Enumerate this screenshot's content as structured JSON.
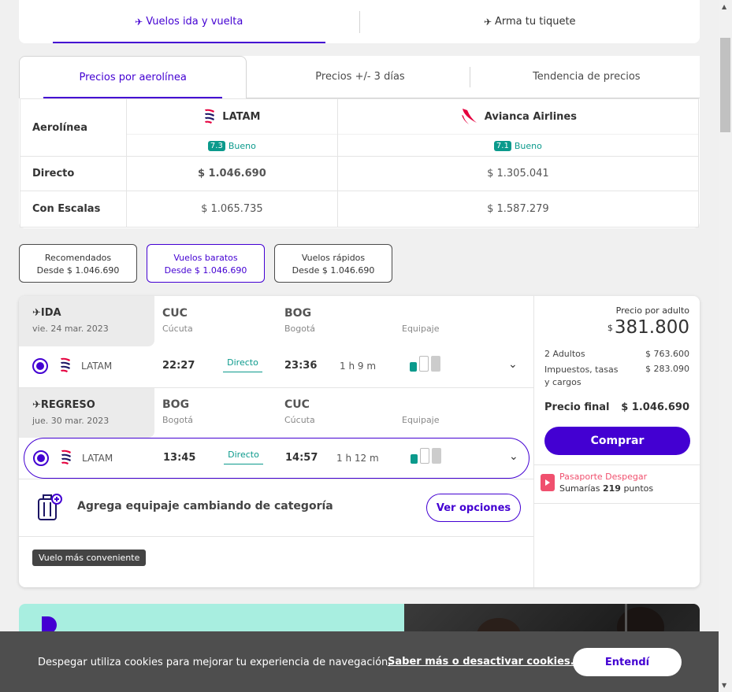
{
  "top_tabs": [
    {
      "label": "Vuelos ida y vuelta",
      "active": true
    },
    {
      "label": "Arma tu tiquete",
      "active": false
    }
  ],
  "matrix": {
    "tabs": [
      {
        "label": "Precios por aerolínea",
        "active": true
      },
      {
        "label": "Precios +/- 3 días",
        "active": false
      },
      {
        "label": "Tendencia de precios",
        "active": false
      }
    ],
    "row_labels": {
      "airline": "Aerolínea",
      "direct": "Directo",
      "stops": "Con Escalas"
    },
    "airlines": [
      {
        "name": "LATAM",
        "score": "7.3",
        "rating": "Bueno",
        "direct": "$ 1.046.690",
        "stops": "$ 1.065.735"
      },
      {
        "name": "Avianca Airlines",
        "score": "7.1",
        "rating": "Bueno",
        "direct": "$ 1.305.041",
        "stops": "$ 1.587.279"
      }
    ]
  },
  "filters": [
    {
      "title": "Recomendados",
      "price": "Desde $ 1.046.690",
      "active": false
    },
    {
      "title": "Vuelos baratos",
      "price": "Desde $ 1.046.690",
      "active": true
    },
    {
      "title": "Vuelos rápidos",
      "price": "Desde $ 1.046.690",
      "active": false
    }
  ],
  "outbound": {
    "title": "IDA",
    "date": "vie. 24 mar. 2023",
    "from_code": "CUC",
    "from_city": "Cúcuta",
    "to_code": "BOG",
    "to_city": "Bogotá",
    "baggage_label": "Equipaje",
    "airline": "LATAM",
    "depart": "22:27",
    "type": "Directo",
    "arrive": "23:36",
    "duration": "1 h 9 m"
  },
  "return": {
    "title": "REGRESO",
    "date": "jue. 30 mar. 2023",
    "from_code": "BOG",
    "from_city": "Bogotá",
    "to_code": "CUC",
    "to_city": "Cúcuta",
    "baggage_label": "Equipaje",
    "airline": "LATAM",
    "depart": "13:45",
    "type": "Directo",
    "arrive": "14:57",
    "duration": "1 h 12 m"
  },
  "upsell": {
    "text": "Agrega equipaje cambiando de categoría",
    "button": "Ver opciones"
  },
  "badge": "Vuelo más conveniente",
  "pricing": {
    "label": "Precio por adulto",
    "currency": "$",
    "per_adult": "381.800",
    "adults_label": "2 Adultos",
    "adults_value": "$ 763.600",
    "taxes_label_1": "Impuestos, tasas",
    "taxes_label_2": "y cargos",
    "taxes_value": "$ 283.090",
    "final_label": "Precio final",
    "final_value": "$ 1.046.690",
    "buy_button": "Comprar",
    "passport_title": "Pasaporte Despegar",
    "passport_prefix": "Sumarías",
    "passport_points": "219",
    "passport_suffix": "puntos"
  },
  "cookie": {
    "text": "Despegar utiliza cookies para mejorar tu experiencia de navegación.",
    "link": "Saber más o desactivar cookies.",
    "button": "Entendí"
  },
  "colors": {
    "brand": "#4300d2",
    "teal": "#0b9a8c",
    "passport": "#f0506e"
  }
}
